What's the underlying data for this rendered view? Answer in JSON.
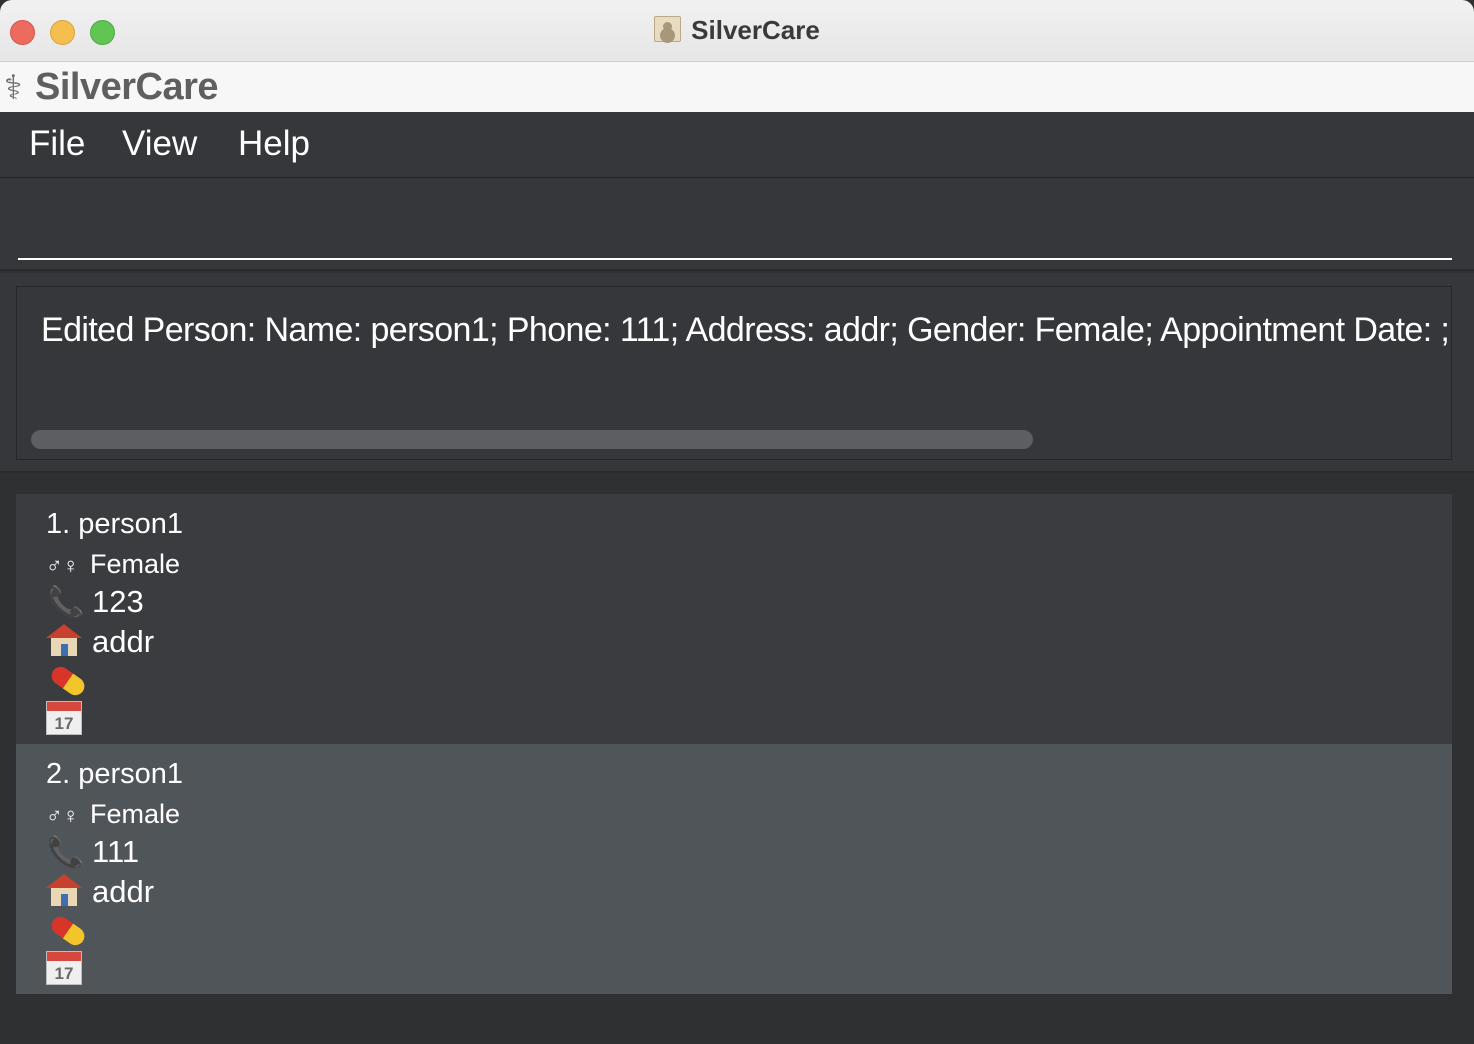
{
  "window": {
    "title": "SilverCare"
  },
  "app_header": {
    "logo_glyph": "⚕",
    "name": "SilverCare"
  },
  "menu": {
    "items": [
      "File",
      "View",
      "Help"
    ]
  },
  "command_box": {
    "value": "",
    "placeholder": ""
  },
  "result_display": {
    "text": "Edited Person: Name: person1; Phone: 111; Address: addr; Gender: Female; Appointment Date: ; Me"
  },
  "persons": [
    {
      "index": "1.",
      "name": "person1",
      "gender": "Female",
      "phone": "123",
      "address": "addr",
      "medication": "",
      "appointment": ""
    },
    {
      "index": "2.",
      "name": "person1",
      "gender": "Female",
      "phone": "111",
      "address": "addr",
      "medication": "",
      "appointment": ""
    }
  ],
  "icons": {
    "gender": "♂♀",
    "phone": "📞",
    "calendar_day": "17"
  },
  "colors": {
    "background": "#2f3032",
    "panel": "#36373a",
    "card_odd": "#3b3c3f",
    "card_selected": "#50555a",
    "text": "#ffffff"
  }
}
